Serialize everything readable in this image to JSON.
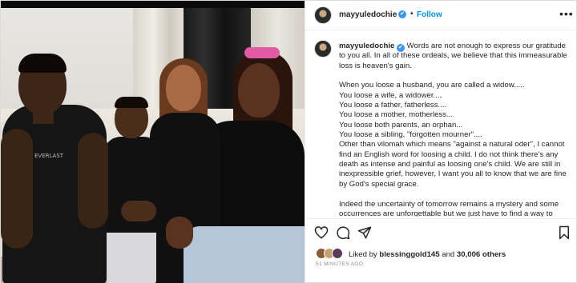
{
  "post": {
    "username": "mayyuledochie",
    "verified_badge": "✔",
    "dot": "•",
    "follow_label": "Follow",
    "more_label": "•••"
  },
  "caption": {
    "username": "mayyuledochie",
    "verified_badge": "✔",
    "lines": [
      "Words are not enough to express our gratitude to you all. In all of these ordeals, we believe that this immeasurable loss is heaven's gain.",
      "",
      "When you loose a husband, you are called a widow.....",
      "You loose a wife, a widower....",
      "You loose a father, fatherless....",
      "You loose a mother, motherless...",
      "You loose both parents, an orphan...",
      "You loose a sibling, \"forgotten mourner\"....",
      "Other than vilomah which means \"against a natural oder\", I cannot find an English word for loosing a child. I do not think there's any death as intense and painful as loosing one's child. We are still in inexpressible grief, however, I want you all to know that we are fine by God's special grace.",
      "",
      "Indeed the uncertainty of tomorrow remains a mystery and some occurrences are unforgettable but we just have to find a way to"
    ]
  },
  "actions": {
    "like_icon": "heart-icon",
    "comment_icon": "comment-icon",
    "share_icon": "share-icon",
    "save_icon": "bookmark-icon"
  },
  "likes": {
    "prefix": "Liked by ",
    "first_user": "blessinggold145",
    "middle": " and ",
    "others": "30,006 others"
  },
  "timestamp": "51 MINUTES AGO",
  "photo": {
    "shirt_print": "EVERLAST"
  }
}
